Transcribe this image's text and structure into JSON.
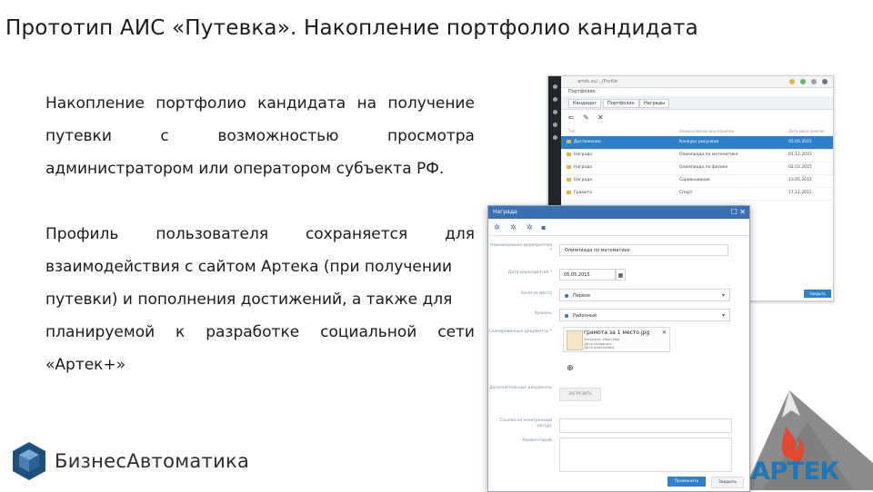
{
  "slide": {
    "title": "Прототип АИС «Путевка». Накопление портфолио кандидата",
    "paragraph1": {
      "line1": [
        "Накопление",
        "портфолио",
        "кандидата",
        "на",
        "получение"
      ],
      "line2": [
        "путевки",
        "с",
        "возможностью",
        "просмотра"
      ],
      "line3": "администратором или оператором субъекта РФ."
    },
    "paragraph2": {
      "line1": [
        "Профиль",
        "пользователя",
        "сохраняется",
        "для"
      ],
      "line2": "взаимодействия с сайтом Артека (при получении",
      "line3": "путевки) и пополнения достижений, а также для",
      "line4": [
        "планируемой",
        "к",
        "разработке",
        "социальной",
        "сети"
      ],
      "line5": "«Артек+»"
    }
  },
  "logo_left": {
    "text": "БизнесАвтоматика",
    "colors": [
      "#1f4f7a",
      "#4b7eb0",
      "#7aa8d4"
    ]
  },
  "logo_right": {
    "text": "АРТЕК",
    "colors": {
      "mountain": "#8c8c8c",
      "flame": "#e2472f",
      "text": "#1d78b8"
    }
  },
  "back_window": {
    "url": "artek.su/.../Profile",
    "page_tab": "Портфолио",
    "tabs": [
      "Кандидат",
      "Портфолио",
      "Награды"
    ],
    "toolbar": [
      "back-icon",
      "edit-icon",
      "delete-icon"
    ],
    "headers": [
      "Тип",
      "Наименование мероприятия",
      "Дата мероприятия"
    ],
    "rows": [
      {
        "type": "Достижение",
        "name": "Конкурс рисунков",
        "date": "05.05.2015",
        "selected": true
      },
      {
        "type": "Награда",
        "name": "Олимпиада по математике",
        "date": "01.12.2015",
        "selected": false
      },
      {
        "type": "Награда",
        "name": "Олимпиада по физике",
        "date": "02.03.2015",
        "selected": false
      },
      {
        "type": "Награда",
        "name": "Соревнование",
        "date": "13.05.2015",
        "selected": false
      },
      {
        "type": "Грамота",
        "name": "Спорт",
        "date": "17.12.2015",
        "selected": false
      }
    ],
    "button": "Закрыть"
  },
  "modal": {
    "title": "Награда",
    "labels": {
      "event_name": "Наименование мероприятия *",
      "event_date": "Дата мероприятия *",
      "place": "Занятое место",
      "level": "Уровень",
      "scanned_docs": "Сканированные документы *",
      "other_docs": "Дополнительные документы",
      "link": "Ссылка на электронный ресурс",
      "comment": "Комментарий"
    },
    "values": {
      "event_name": "Олимпиада по математике",
      "event_date": "05.05.2015",
      "place": "Первое",
      "level": "Районный"
    },
    "file": {
      "name": "грамота за 1 место.jpg",
      "meta": [
        "Загрузил: Иван Ива",
        "Дата создания:",
        "Дата изменения:"
      ]
    },
    "upload_label": "ЗАГРУЗИТЬ",
    "apply_label": "Применить",
    "close_label": "Закрыть"
  }
}
